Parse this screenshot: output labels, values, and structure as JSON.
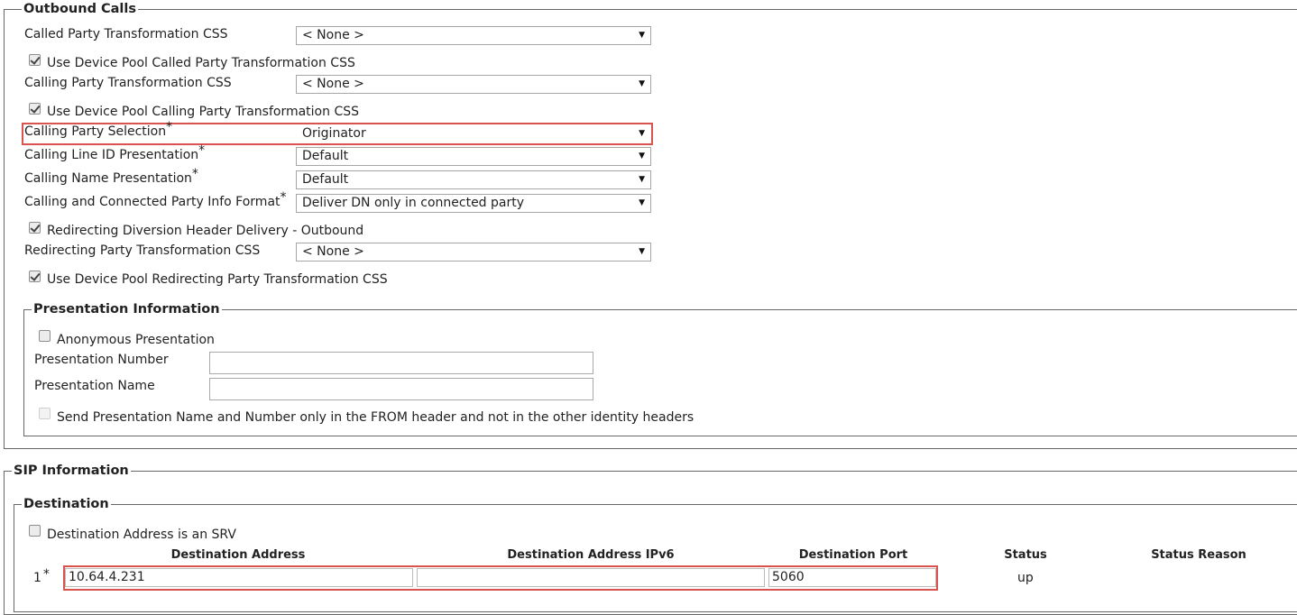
{
  "outbound": {
    "legend": "Outbound Calls",
    "called_css_label": "Called Party Transformation CSS",
    "called_css_value": "< None >",
    "use_pool_called_label": "Use Device Pool Called Party Transformation CSS",
    "calling_css_label": "Calling Party Transformation CSS",
    "calling_css_value": "< None >",
    "use_pool_calling_label": "Use Device Pool Calling Party Transformation CSS",
    "calling_party_selection_label": "Calling Party Selection",
    "calling_party_selection_value": "Originator",
    "calling_line_id_label": "Calling Line ID Presentation",
    "calling_line_id_value": "Default",
    "calling_name_label": "Calling Name Presentation",
    "calling_name_value": "Default",
    "info_format_label": "Calling and Connected Party Info Format",
    "info_format_value": "Deliver DN only in connected party",
    "redirecting_diversion_label": "Redirecting Diversion Header Delivery - Outbound",
    "redirecting_css_label": "Redirecting Party Transformation CSS",
    "redirecting_css_value": "< None >",
    "use_pool_redirecting_label": "Use Device Pool Redirecting Party Transformation CSS",
    "required_mark": "*"
  },
  "presentation": {
    "legend": "Presentation Information",
    "anonymous_label": "Anonymous Presentation",
    "number_label": "Presentation Number",
    "number_value": "",
    "name_label": "Presentation Name",
    "name_value": "",
    "from_header_label": "Send Presentation Name and Number only in the FROM header and not in the other identity headers"
  },
  "sip": {
    "legend": "SIP Information",
    "destination": {
      "legend": "Destination",
      "srv_label": "Destination Address is an SRV",
      "columns": [
        "Destination Address",
        "Destination Address IPv6",
        "Destination Port",
        "Status",
        "Status Reason"
      ],
      "rows": [
        {
          "index": "1",
          "required": "*",
          "address": "10.64.4.231",
          "ipv6": "",
          "port": "5060",
          "status": "up",
          "reason": ""
        }
      ]
    }
  },
  "colors": {
    "highlight": "#d9534f",
    "border": "#666666"
  },
  "icons": {
    "select_arrow": "dropdown-arrow-icon",
    "checkbox": "checkbox-icon"
  }
}
